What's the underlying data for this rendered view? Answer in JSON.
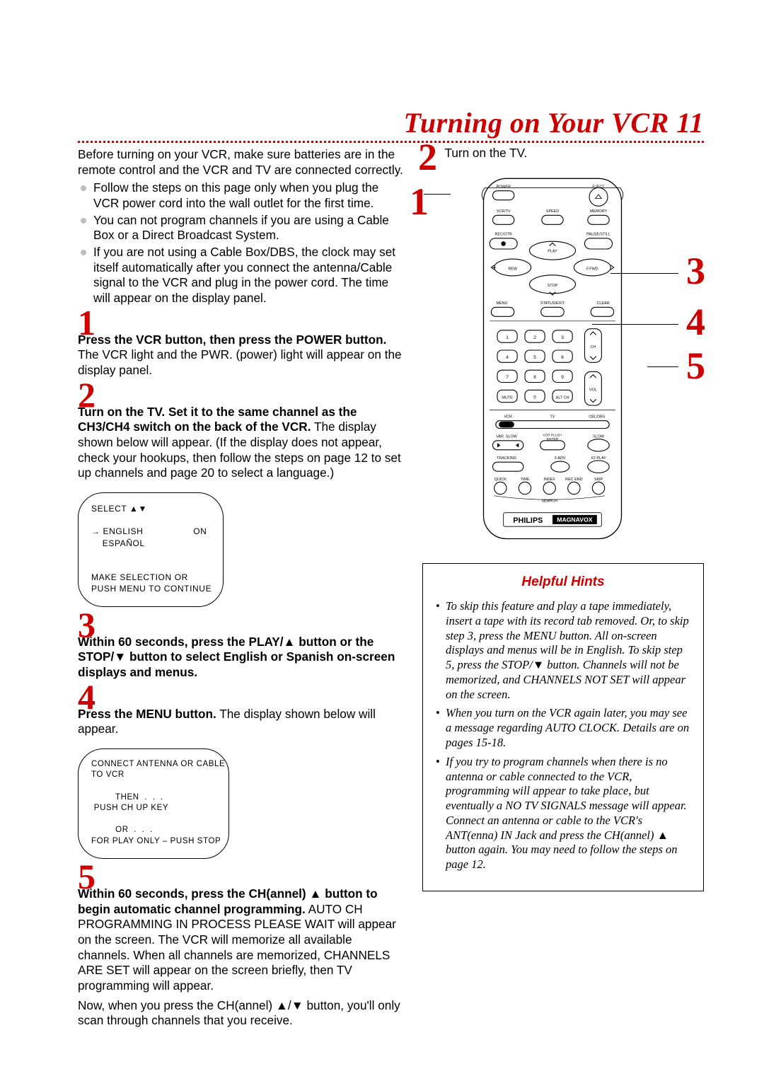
{
  "title": "Turning on Your VCR  11",
  "intro": "Before turning on your VCR, make sure batteries are in the remote control and the VCR and TV are connected correctly.",
  "bullets": [
    "Follow the steps on this page only when you plug the VCR power cord into the wall outlet for the first time.",
    "You can not program channels if you are using a Cable Box or a Direct Broadcast System.",
    "If you are not using a Cable Box/DBS, the clock may set itself automatically after you connect the antenna/Cable signal to the VCR and plug in the power cord. The time will appear on the display panel."
  ],
  "steps": {
    "s1": {
      "num": "1",
      "bold": "Press the VCR button, then press the POWER button.",
      "rest": " The VCR light and the PWR. (power) light will appear on the display panel."
    },
    "s2": {
      "num": "2",
      "bold": "Turn on the TV. Set it to the same channel as the CH3/CH4 switch on the back of the VCR.",
      "rest": " The display shown below will appear. (If the display does not appear, check your hookups, then follow the steps on page 12 to set up channels and page 20 to select a language.)"
    },
    "s3": {
      "num": "3",
      "bold": "Within 60 seconds, press the PLAY/▲ button or the STOP/▼ button to select English or Spanish on-screen displays and menus."
    },
    "s4": {
      "num": "4",
      "bold": "Press the MENU button.",
      "rest": " The display shown below will appear."
    },
    "s5": {
      "num": "5",
      "bold": "Within 60 seconds, press the CH(annel) ▲ button to begin automatic channel programming.",
      "rest": " AUTO CH PROGRAMMING IN PROCESS PLEASE WAIT will appear on the screen. The VCR will memorize all available channels. When all channels are memorized, CHANNELS ARE SET will appear on the screen briefly, then TV programming will appear.",
      "tail": "Now, when you press the CH(annel) ▲/▼ button, you'll only scan through channels that you receive."
    }
  },
  "panel1": "SELECT ▲▼\n\n→ ENGLISH                  ON\n    ESPAÑOL\n\n\nMAKE SELECTION OR\nPUSH MENU TO CONTINUE",
  "panel2": "CONNECT ANTENNA OR CABLE\nTO VCR\n\n         THEN  .  .  .\n PUSH CH UP KEY\n\n         OR  .  .  .\nFOR PLAY ONLY – PUSH STOP",
  "right_step2": {
    "num": "2",
    "text": "Turn on the TV."
  },
  "remote": {
    "top": [
      "POWER",
      "EJECT",
      "VCR/TV",
      "SPEED",
      "MEMORY",
      "REC/OTR",
      "PAUSE/STILL",
      "PLAY",
      "REW",
      "F.FWD",
      "STOP",
      "MENU",
      "STATUS/EXIT",
      "CLEAR"
    ],
    "numpad_other": [
      "MUTE",
      "ALT CH",
      "CH",
      "VOL"
    ],
    "bottom": [
      "VCR",
      "TV",
      "CBL/DBS",
      "VAR. SLOW",
      "VCR PLUS+\nENTER",
      "SLOW",
      "TRACKING",
      "F.ADV",
      "X2 PLAY",
      "QUICK",
      "TIME",
      "INDEX",
      "REC END",
      "SKIP",
      "SEARCH"
    ],
    "brand": "PHILIPS",
    "brand2": "MAGNAVOX"
  },
  "hints": {
    "title": "Helpful Hints",
    "items": [
      "To skip this feature and play a tape immediately, insert a tape with its record tab removed. Or, to skip step 3, press the MENU button. All on-screen displays and menus will be in English. To skip step 5, press the STOP/▼ button.  Channels will not be memorized, and CHANNELS NOT SET will appear on the screen.",
      "When you turn on the VCR again later, you may see a message regarding AUTO CLOCK. Details are on pages 15-18.",
      "If you try to program channels when there is no antenna or cable connected to the VCR, programming will appear to take place, but eventually a NO TV SIGNALS message will appear. Connect an antenna or cable to the VCR's ANT(enna) IN Jack and press the CH(annel) ▲ button again. You may need to follow the steps on page 12."
    ]
  }
}
